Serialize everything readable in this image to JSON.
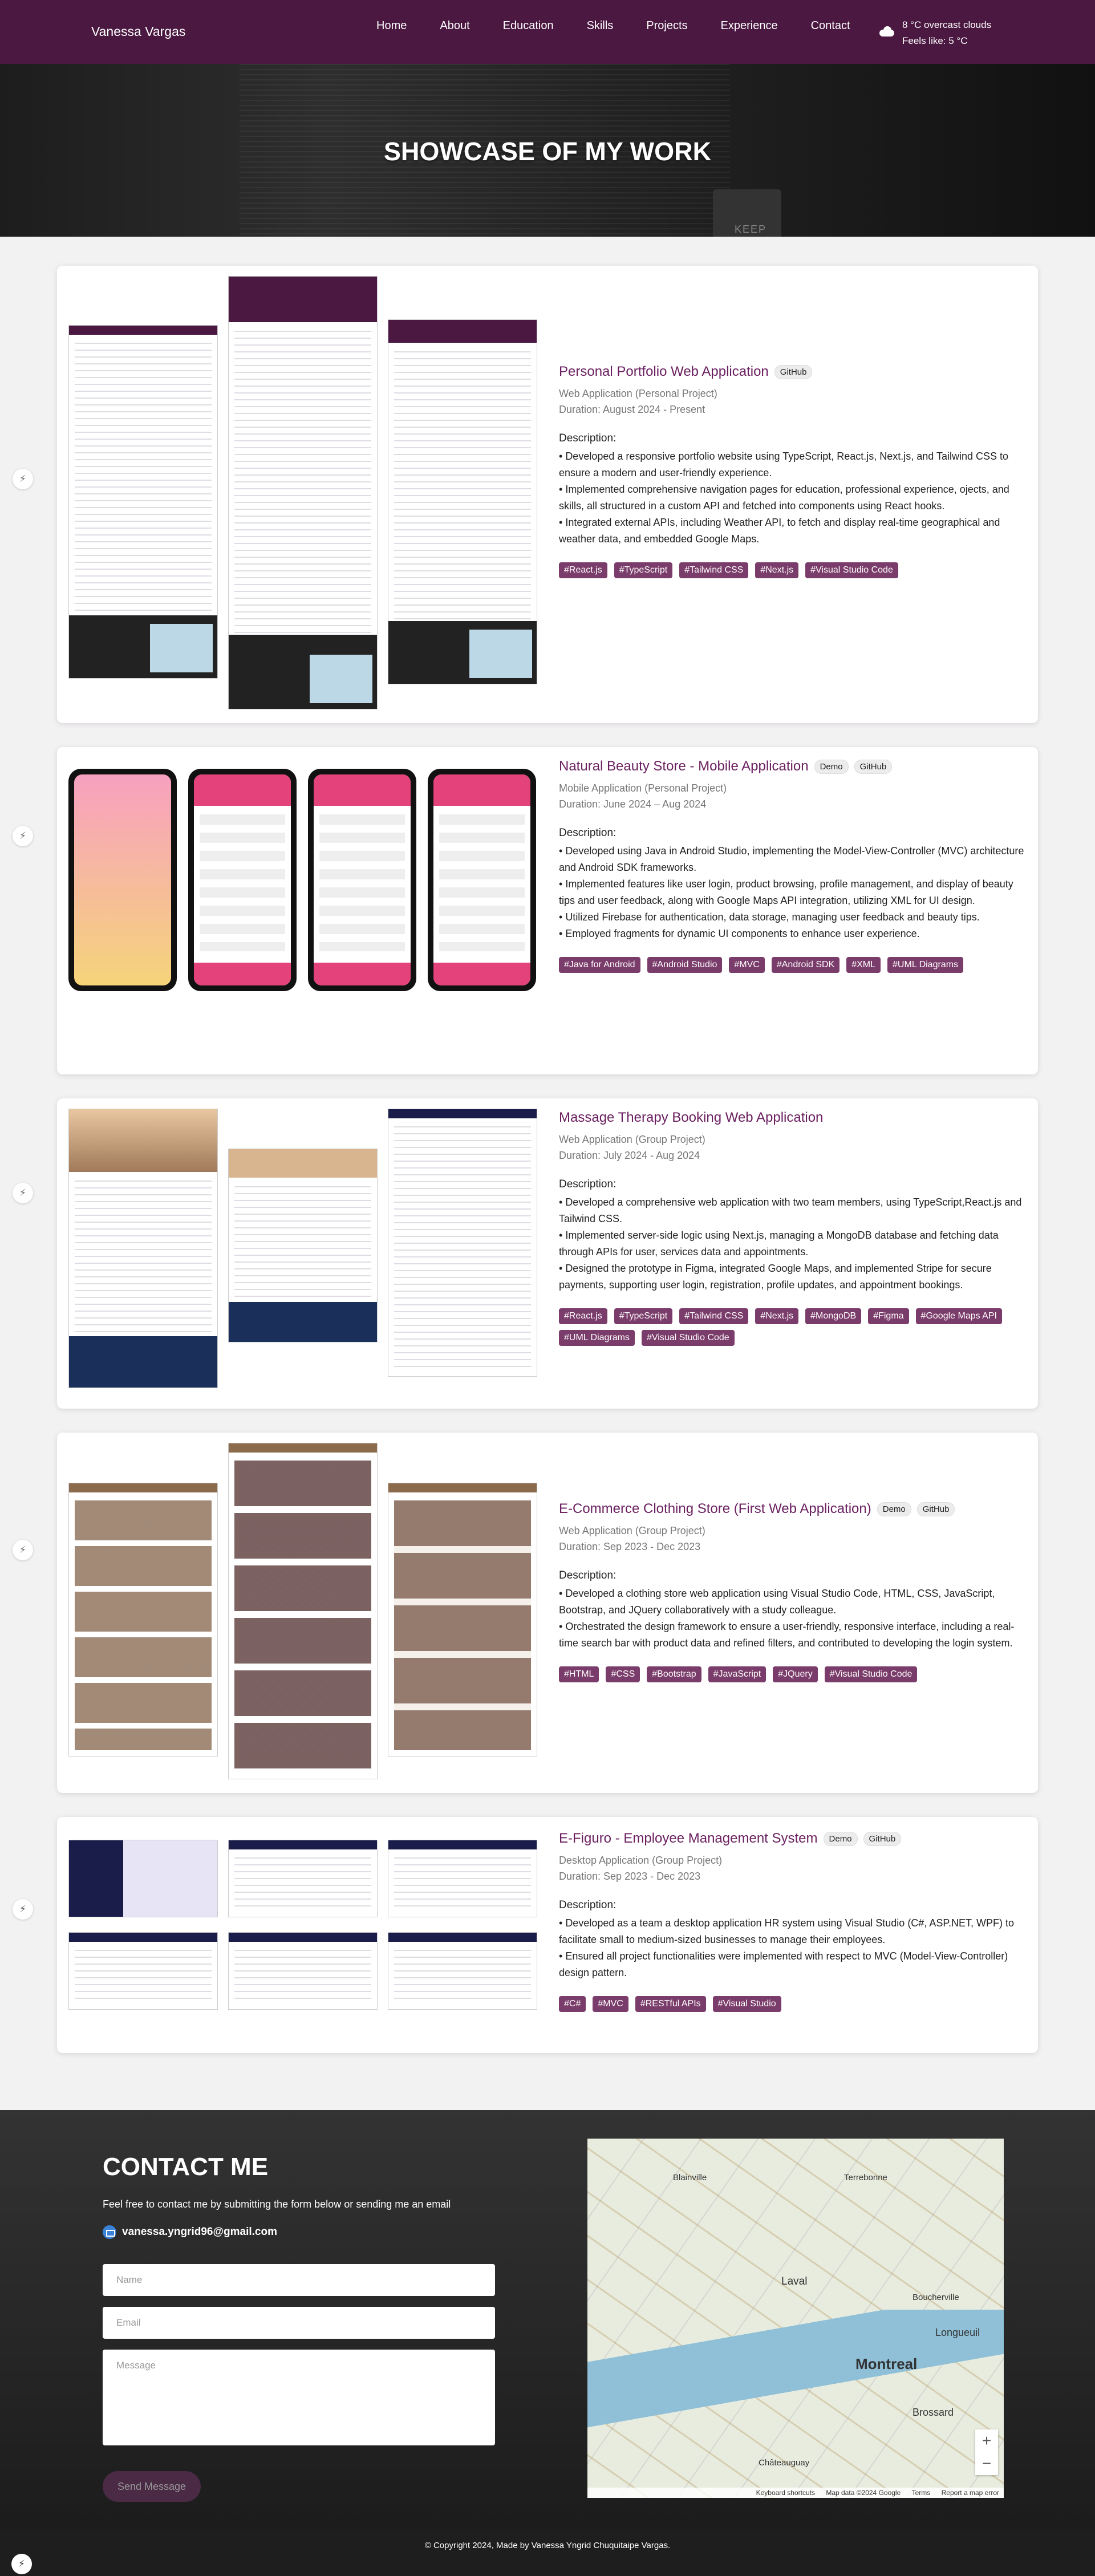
{
  "nav": {
    "brand": "Vanessa Vargas",
    "links": [
      "Home",
      "About",
      "Education",
      "Skills",
      "Projects",
      "Experience",
      "Contact"
    ],
    "weather_temp": "8 °C  overcast clouds",
    "weather_feels": "Feels like: 5 °C",
    "weather_icon": "cloud-icon"
  },
  "hero": {
    "title": "SHOWCASE OF MY WORK",
    "mug_text": "KEEP"
  },
  "projects": [
    {
      "title": "Personal Portfolio Web Application",
      "pills": [
        "GitHub"
      ],
      "type": "Web Application (Personal Project)",
      "duration": "Duration: August 2024 - Present",
      "desc_label": "Description:",
      "bullets": [
        "Developed a responsive portfolio website using TypeScript, React.js, Next.js, and Tailwind CSS to ensure a modern and user-friendly experience.",
        "Implemented comprehensive navigation pages for education, professional experience, ojects, and skills, all structured in a custom API and fetched into components using React hooks.",
        "Integrated external APIs, including Weather API, to fetch and display real-time geographical and weather data, and embedded Google Maps."
      ],
      "tags": [
        "#React.js",
        "#TypeScript",
        "#Tailwind CSS",
        "#Next.js",
        "#Visual Studio Code"
      ]
    },
    {
      "title": "Natural Beauty Store - Mobile Application",
      "pills": [
        "Demo",
        "GitHub"
      ],
      "type": "Mobile Application (Personal Project)",
      "duration": "Duration: June 2024 – Aug 2024",
      "desc_label": "Description:",
      "bullets": [
        "Developed using Java in Android Studio, implementing the Model-View-Controller (MVC) architecture and Android SDK frameworks.",
        "Implemented features like user login, product browsing, profile management, and display of beauty tips and user feedback, along with Google Maps API integration, utilizing XML for UI design.",
        "Utilized Firebase for authentication, data storage, managing user feedback and beauty tips.",
        "Employed fragments for dynamic UI components to enhance user experience."
      ],
      "tags": [
        "#Java for Android",
        "#Android Studio",
        "#MVC",
        "#Android SDK",
        "#XML",
        "#UML Diagrams"
      ]
    },
    {
      "title": "Massage Therapy Booking Web Application",
      "pills": [],
      "type": "Web Application (Group Project)",
      "duration": "Duration: July 2024 - Aug 2024",
      "desc_label": "Description:",
      "bullets": [
        "Developed a comprehensive web application with two team members, using TypeScript,React.js and Tailwind CSS.",
        "Implemented server-side logic using Next.js, managing a MongoDB database and fetching data through APIs for user, services data and appointments.",
        "Designed the prototype in Figma, integrated Google Maps, and implemented Stripe for secure payments, supporting user login, registration, profile updates, and appointment bookings."
      ],
      "tags": [
        "#React.js",
        "#TypeScript",
        "#Tailwind CSS",
        "#Next.js",
        "#MongoDB",
        "#Figma",
        "#Google Maps API",
        "#UML Diagrams",
        "#Visual Studio Code"
      ]
    },
    {
      "title": "E-Commerce Clothing Store (First Web Application)",
      "pills": [
        "Demo",
        "GitHub"
      ],
      "type": "Web Application (Group Project)",
      "duration": "Duration: Sep 2023 - Dec 2023",
      "desc_label": "Description:",
      "bullets": [
        "Developed a clothing store web application using Visual Studio Code, HTML, CSS, JavaScript, Bootstrap, and JQuery collaboratively with a study colleague.",
        "Orchestrated the design framework to ensure a user-friendly, responsive interface, including a real-time search bar with product data and refined filters, and contributed to developing the login system."
      ],
      "tags": [
        "#HTML",
        "#CSS",
        "#Bootstrap",
        "#JavaScript",
        "#JQuery",
        "#Visual Studio Code"
      ]
    },
    {
      "title": "E-Figuro - Employee Management System",
      "pills": [
        "Demo",
        "GitHub"
      ],
      "type": "Desktop Application (Group Project)",
      "duration": "Duration: Sep 2023 - Dec 2023",
      "desc_label": "Description:",
      "bullets": [
        "Developed as a team a desktop application HR system using Visual Studio (C#, ASP.NET, WPF) to facilitate small to medium-sized businesses to manage their employees.",
        "Ensured all project functionalities were implemented with respect to MVC (Model-View-Controller) design pattern."
      ],
      "tags": [
        "#C#",
        "#MVC",
        "#RESTful APIs",
        "#Visual Studio"
      ]
    }
  ],
  "contact": {
    "title": "CONTACT ME",
    "lead": "Feel free to contact me by submitting the form below or sending me an email",
    "email": "vanessa.yngrid96@gmail.com",
    "name_placeholder": "Name",
    "email_placeholder": "Email",
    "message_placeholder": "Message",
    "send_label": "Send Message",
    "map_labels": {
      "city": "Montreal",
      "laval": "Laval",
      "longueuil": "Longueuil",
      "brossard": "Brossard",
      "terrebonne": "Terrebonne",
      "blainville": "Blainville",
      "boucherville": "Boucherville",
      "chateauguay": "Châteauguay"
    },
    "map_footer": [
      "Keyboard shortcuts",
      "Map data ©2024 Google",
      "Terms",
      "Report a map error"
    ]
  },
  "footer": {
    "copyright": "© Copyright 2024, Made by Vanessa Yngrid Chuquitaipe Vargas."
  }
}
